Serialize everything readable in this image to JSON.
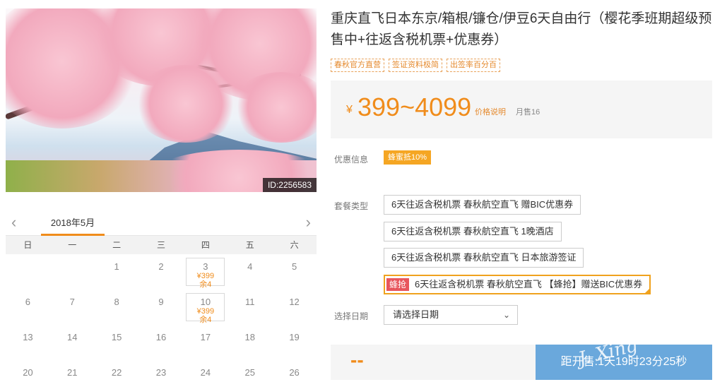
{
  "product": {
    "title": "重庆直飞日本东京/箱根/镰仓/伊豆6天自由行（樱花季班期超级预售中+往返含税机票+优惠券）",
    "tags": [
      "春秋官方直营",
      "签证资料极简",
      "出签率百分百"
    ],
    "image_id": "ID:2256583"
  },
  "price": {
    "currency": "¥",
    "range": "399~4099",
    "explain": "价格说明",
    "monthly_sales": "月售16"
  },
  "promo": {
    "label": "优惠信息",
    "badge": "蜂蜜抵10%"
  },
  "packages": {
    "label": "套餐类型",
    "items": [
      {
        "text": "6天往返含税机票 春秋航空直飞 赠BIC优惠券"
      },
      {
        "text": "6天往返含税机票 春秋航空直飞 1晚酒店"
      },
      {
        "text": "6天往返含税机票 春秋航空直飞 日本旅游签证"
      },
      {
        "badge": "蜂抢",
        "text": "6天往返含税机票 春秋航空直飞 【蜂抢】赠送BIC优惠券"
      }
    ]
  },
  "date_select": {
    "label": "选择日期",
    "placeholder": "请选择日期"
  },
  "bottom": {
    "price_placeholder": "--",
    "buy_button": "距开售:1天19时23分25秒",
    "watermark": "J. Xing"
  },
  "calendar": {
    "month": "2018年5月",
    "weekdays": [
      "日",
      "一",
      "二",
      "三",
      "四",
      "五",
      "六"
    ],
    "days": [
      {
        "d": ""
      },
      {
        "d": ""
      },
      {
        "d": "1"
      },
      {
        "d": "2"
      },
      {
        "d": "3",
        "price": "¥399",
        "left": "余4"
      },
      {
        "d": "4"
      },
      {
        "d": "5"
      },
      {
        "d": "6"
      },
      {
        "d": "7"
      },
      {
        "d": "8"
      },
      {
        "d": "9"
      },
      {
        "d": "10",
        "price": "¥399",
        "left": "余4"
      },
      {
        "d": "11"
      },
      {
        "d": "12"
      },
      {
        "d": "13"
      },
      {
        "d": "14"
      },
      {
        "d": "15"
      },
      {
        "d": "16"
      },
      {
        "d": "17"
      },
      {
        "d": "18"
      },
      {
        "d": "19"
      },
      {
        "d": "20"
      },
      {
        "d": "21"
      },
      {
        "d": "22"
      },
      {
        "d": "23"
      },
      {
        "d": "24"
      },
      {
        "d": "25"
      },
      {
        "d": "26"
      }
    ]
  }
}
